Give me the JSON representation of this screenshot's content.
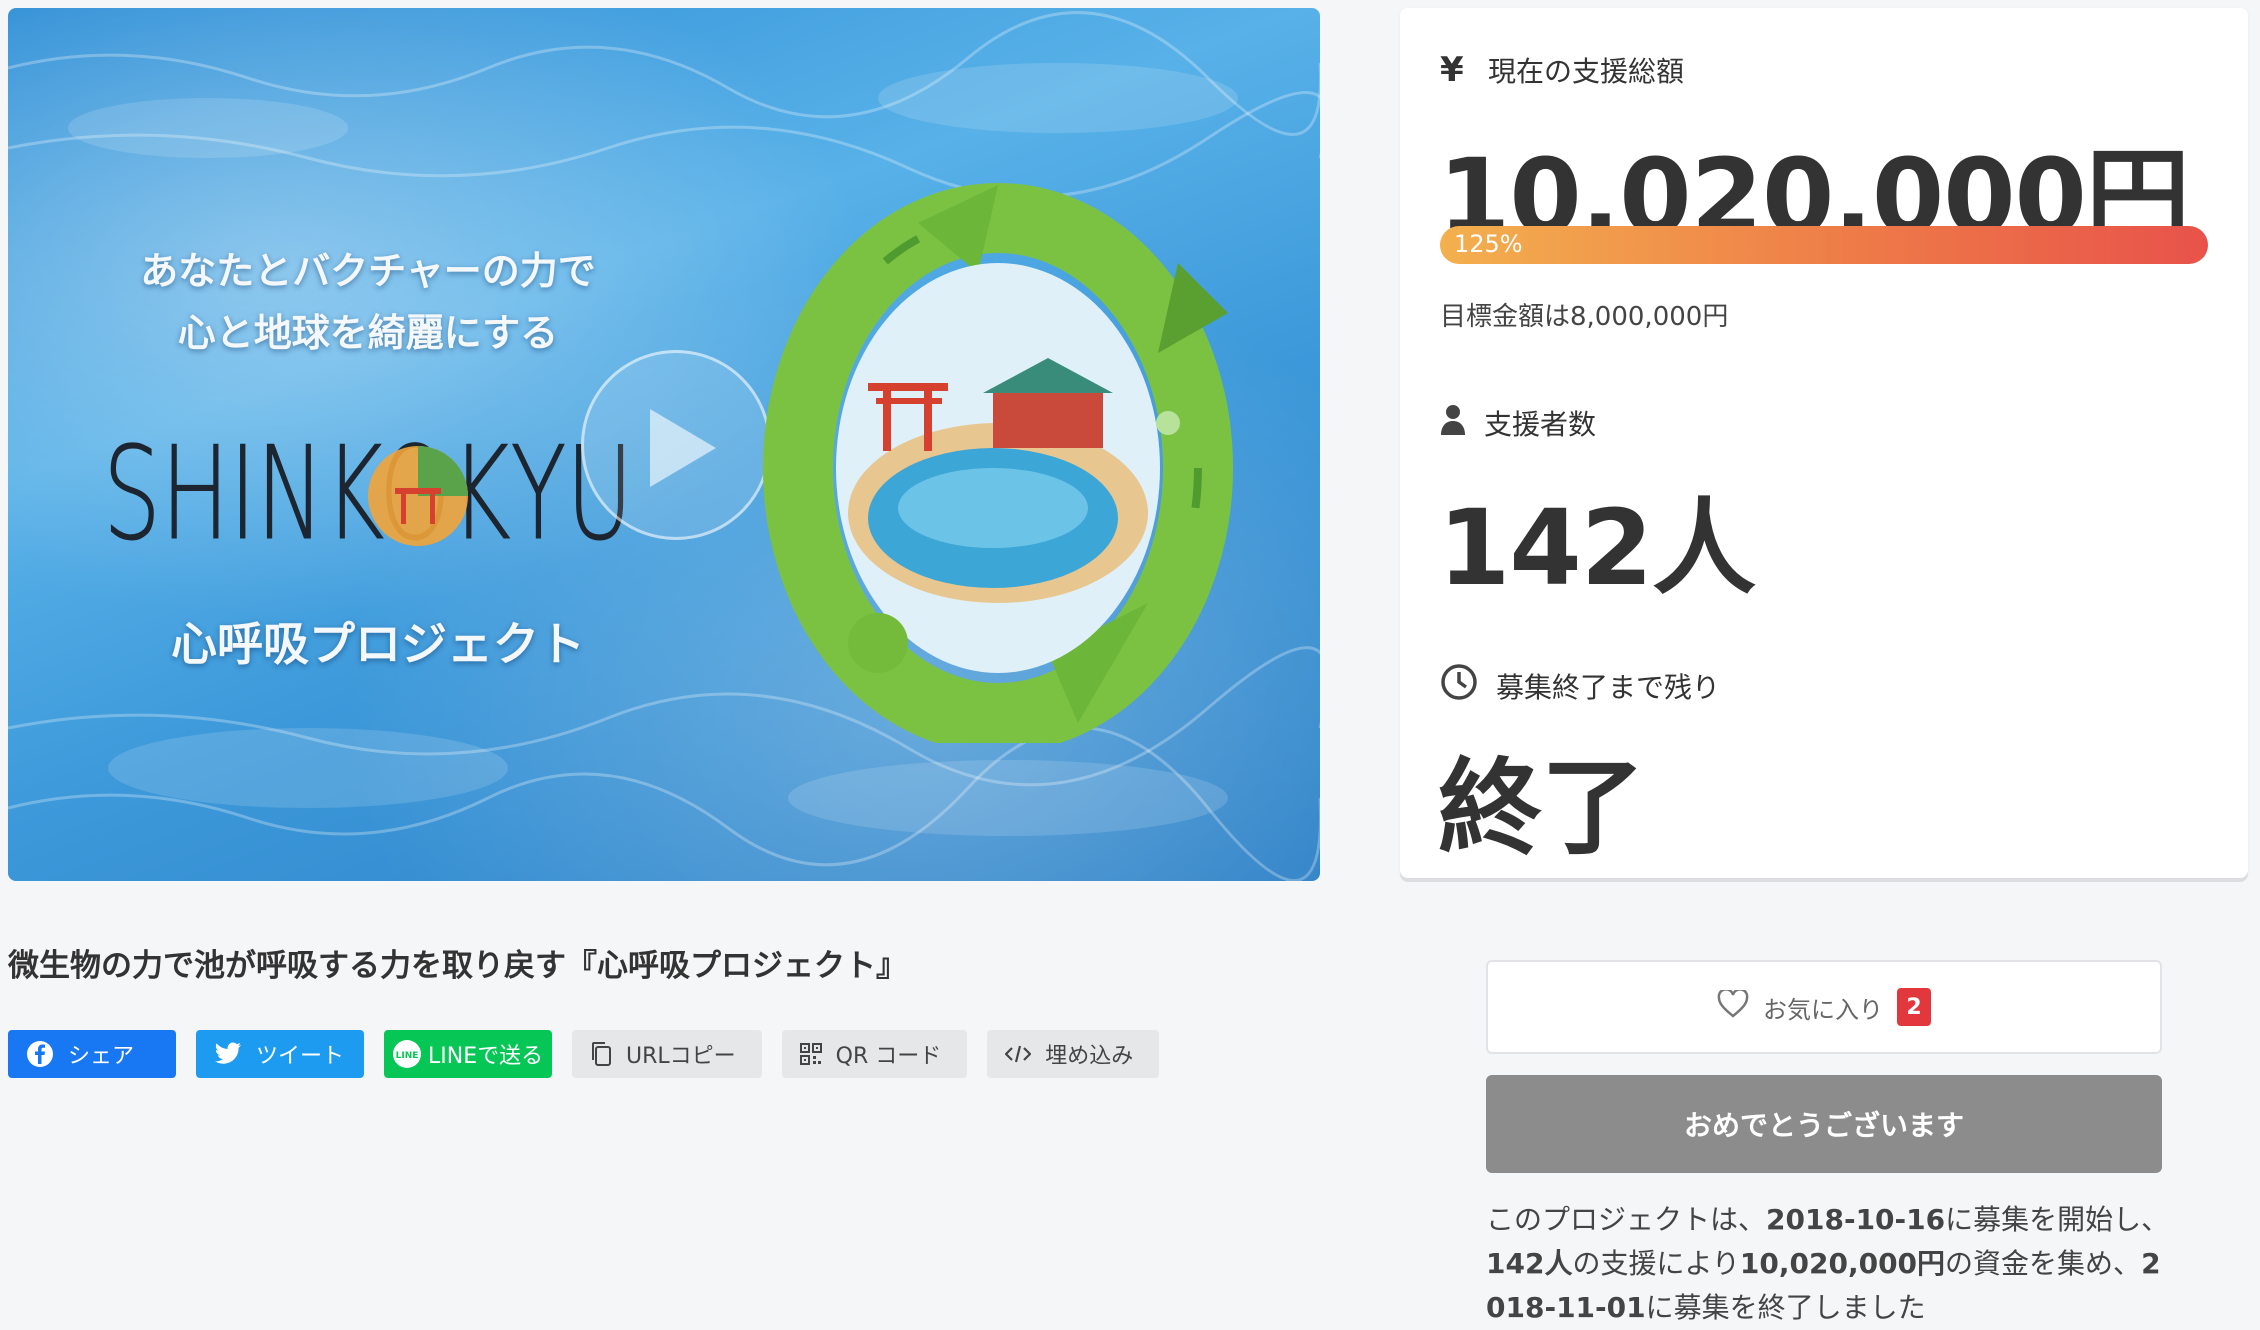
{
  "hero": {
    "tagline_line1": "あなたとバクチャーの力で",
    "tagline_line2": "心と地球を綺麗にする",
    "logo_text": "SHINKOKYU",
    "subtitle": "心呼吸プロジェクト",
    "play_icon": "play-icon"
  },
  "project": {
    "title": "微生物の力で池が呼吸する力を取り戻す『心呼吸プロジェクト』"
  },
  "share": {
    "facebook": "シェア",
    "twitter": "ツイート",
    "line": "LINEで送る",
    "url_copy": "URLコピー",
    "qr_code": "QR コード",
    "embed": "埋め込み"
  },
  "stats": {
    "total_label": "現在の支援総額",
    "total_value": "10,020,000円",
    "progress_text": "125%",
    "progress_percent": 125,
    "goal_text": "目標金額は8,000,000円",
    "backers_label": "支援者数",
    "backers_value": "142人",
    "remaining_label": "募集終了まで残り",
    "remaining_value": "終了"
  },
  "actions": {
    "favorite_label": "お気に入り",
    "favorite_count": "2",
    "congrats_label": "おめでとうございます"
  },
  "summary": {
    "p1": "このプロジェクトは、",
    "start_date": "2018-10-16",
    "p2": "に募集を開始し、",
    "backers": "142人",
    "p3": "の支援により",
    "amount": "10,020,000円",
    "p4": "の資金を集め、",
    "end_date": "2018-11-01",
    "p5": "に募集を終了しました"
  },
  "colors": {
    "facebook": "#1877f2",
    "twitter": "#1d9bf0",
    "line": "#06c755",
    "progress_start": "#f3b04e",
    "progress_end": "#e8524a",
    "badge": "#e2383d",
    "congrats_bg": "#8c8c8c"
  }
}
